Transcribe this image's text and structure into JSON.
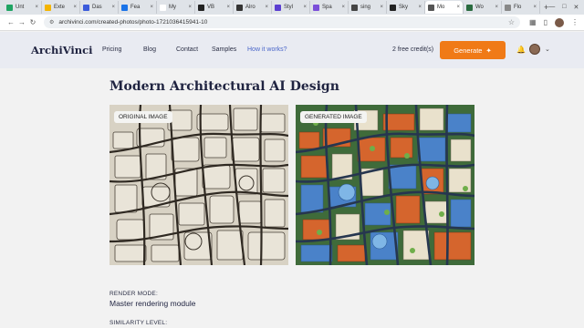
{
  "browser": {
    "tabs": [
      {
        "label": "Unt",
        "color": "#1fa463"
      },
      {
        "label": "Exte",
        "color": "#f4b400"
      },
      {
        "label": "Das",
        "color": "#3b5bdb"
      },
      {
        "label": "Fea",
        "color": "#1a73e8"
      },
      {
        "label": "My",
        "color": "#ffffff"
      },
      {
        "label": "VB",
        "color": "#222222"
      },
      {
        "label": "Alro",
        "color": "#333333"
      },
      {
        "label": "Styl",
        "color": "#5b3fd1"
      },
      {
        "label": "Spa",
        "color": "#7b4fd9"
      },
      {
        "label": "sing",
        "color": "#444444"
      },
      {
        "label": "Sky",
        "color": "#222222"
      },
      {
        "label": "Mo",
        "color": "#555555"
      },
      {
        "label": "Wo",
        "color": "#2a6b3f"
      },
      {
        "label": "Flo",
        "color": "#888888"
      }
    ],
    "active_tab_index": 11,
    "url": "archivinci.com/created-photos/photo-1721036415941-10"
  },
  "header": {
    "logo": "ArchiVinci",
    "nav": [
      "Pricing",
      "Blog",
      "Contact",
      "Samples",
      "How it works?"
    ],
    "credits": "2 free credit(s)",
    "generate_label": "Generate"
  },
  "main": {
    "title": "Modern Architectural AI Design",
    "original_label": "ORIGINAL IMAGE",
    "generated_label": "GENERATED IMAGE",
    "render_mode_label": "RENDER MODE:",
    "render_mode_value": "Master rendering module",
    "similarity_label": "SIMILARITY LEVEL:"
  },
  "colors": {
    "accent": "#f07a17",
    "header_bg": "#e9ebf2",
    "link": "#4a66c9"
  }
}
